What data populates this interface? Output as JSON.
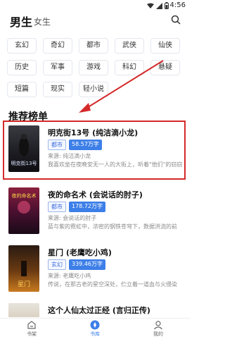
{
  "status": {
    "time": "4:56"
  },
  "header": {
    "tab_male": "男生",
    "tab_female": "女生"
  },
  "genres": [
    "玄幻",
    "奇幻",
    "都市",
    "武侠",
    "仙侠",
    "历史",
    "军事",
    "游戏",
    "科幻",
    "悬疑",
    "短篇",
    "现实",
    "轻小说"
  ],
  "section_title": "推荐榜单",
  "books": [
    {
      "title": "明克街13号 (纯洁滴小龙)",
      "genre": "都市",
      "words": "58.57万字",
      "source": "来源: 纯洁滴小龙",
      "desc": "我喜欢坐在夜晚安无一人的大街上，听着\"他们\"的窃窃",
      "cover_text": "明克街13号"
    },
    {
      "title": "夜的命名术 (会说话的肘子)",
      "genre": "都市",
      "words": "178.72万字",
      "source": "来源: 会说话的肘子",
      "desc": "蓝与紫的霓虹中，浓密的钢铁苍穹下，数据洪流的前",
      "cover_text": "夜的命名术"
    },
    {
      "title": "星门 (老鹰吃小鸡)",
      "genre": "玄幻",
      "words": "339.46万字",
      "source": "来源: 老鹰吃小鸡",
      "desc": "传说，在那古老的星空深处，伫立着一道血与火侵染",
      "cover_text": "星门"
    },
    {
      "title": "这个人仙太过正经 (言归正传)",
      "genre": "",
      "words": "",
      "source": "",
      "desc": "",
      "cover_text": ""
    }
  ],
  "nav": {
    "shelf": "书架",
    "library": "书库",
    "mine": "我的"
  },
  "colors": {
    "accent": "#3d7fe8",
    "highlight": "#d42a2a"
  }
}
